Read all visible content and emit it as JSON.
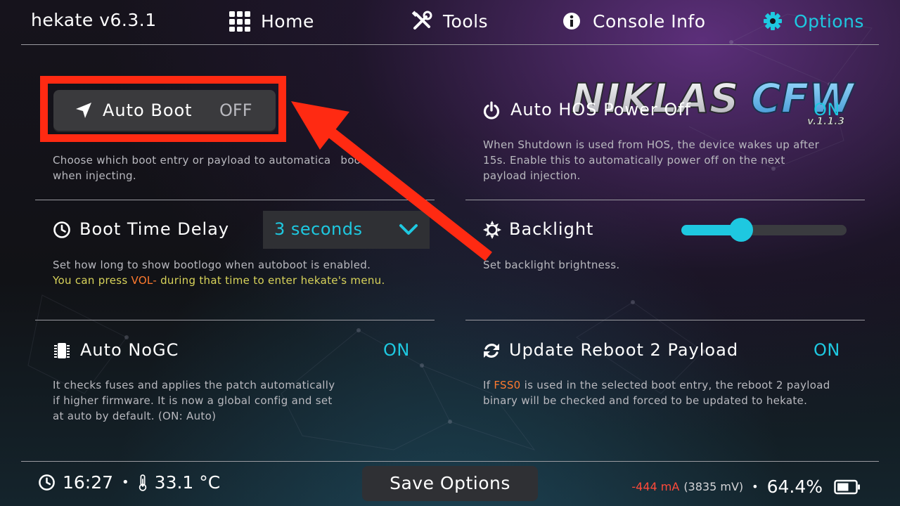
{
  "app": {
    "title": "hekate  v6.3.1"
  },
  "tabs": [
    {
      "label": "Home",
      "icon": "grid-icon"
    },
    {
      "label": "Tools",
      "icon": "tools-icon"
    },
    {
      "label": "Console Info",
      "icon": "info-icon"
    },
    {
      "label": "Options",
      "icon": "gear-icon",
      "active": true
    }
  ],
  "options": {
    "auto_boot": {
      "label": "Auto Boot",
      "value": "OFF",
      "desc1": "Choose which boot entry or payload to automatica",
      "desc1b": "boot",
      "desc2": "when injecting."
    },
    "auto_hos_power_off": {
      "label": "Auto HOS Power Off",
      "value": "ON",
      "desc1": "When Shutdown is used from HOS, the device wakes up after",
      "desc2": "15s. Enable this to automatically power off on the next",
      "desc3": "payload injection."
    },
    "boot_time_delay": {
      "label": "Boot Time Delay",
      "value": "3 seconds",
      "desc1": "Set how long to show bootlogo when autoboot is enabled.",
      "desc2a": "You can press ",
      "desc2b": "VOL-",
      "desc2c": " during that time to enter hekate's menu."
    },
    "backlight": {
      "label": "Backlight",
      "desc": "Set backlight brightness.",
      "level": 0.36
    },
    "auto_nogc": {
      "label": "Auto NoGC",
      "value": "ON",
      "desc1": "It checks fuses and applies the patch automatically",
      "desc2": "if higher firmware. It is now a global config and set",
      "desc3": "at auto by default. (ON: Auto)"
    },
    "update_reboot_payload": {
      "label": "Update Reboot 2 Payload",
      "value": "ON",
      "desc1a": "If ",
      "desc1b": "FSS0",
      "desc1c": " is used in the selected boot entry, the reboot 2 payload",
      "desc2": "binary will be checked and forced to be updated to hekate."
    }
  },
  "logo": {
    "text": "NIKLASCFW",
    "version": "v.1.1.3"
  },
  "status": {
    "time": "16:27",
    "sep": "•",
    "temperature": "33.1 °C",
    "save_label": "Save Options",
    "current": "-444 mA",
    "voltage": "(3835 mV)",
    "battery": "64.4%"
  },
  "colors": {
    "accent": "#1ec8e0",
    "highlight": "#ff2a12",
    "warn": "#d8d35a",
    "orange": "#ff7a2e"
  }
}
